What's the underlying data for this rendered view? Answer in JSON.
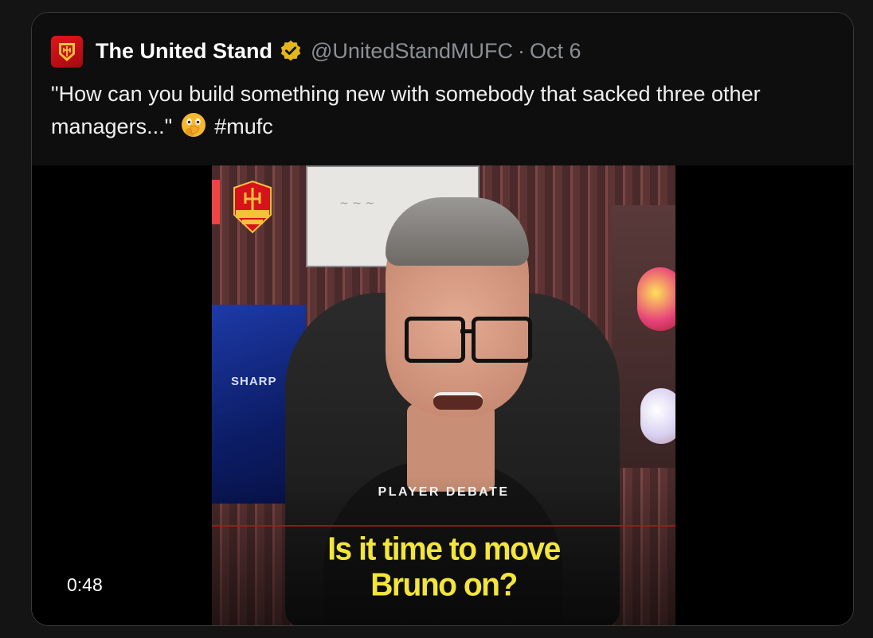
{
  "tweet": {
    "display_name": "The United Stand",
    "handle": "@UnitedStandMUFC",
    "separator": "·",
    "date": "Oct 6",
    "text_before_emoji": "\"How can you build something new with somebody that sacked three other managers...\"",
    "emoji": "face-with-open-eyes-and-hand-over-mouth",
    "hashtag": "#mufc"
  },
  "media": {
    "duration": "0:48",
    "overlay_label": "PLAYER DEBATE",
    "headline_line1": "Is it time to move",
    "headline_line2": "Bruno on?",
    "jersey_text": "SHARP"
  },
  "colors": {
    "brand_red": "#e3141c",
    "verified_gold": "#e2b719",
    "headline_yellow": "#f3e53a"
  }
}
